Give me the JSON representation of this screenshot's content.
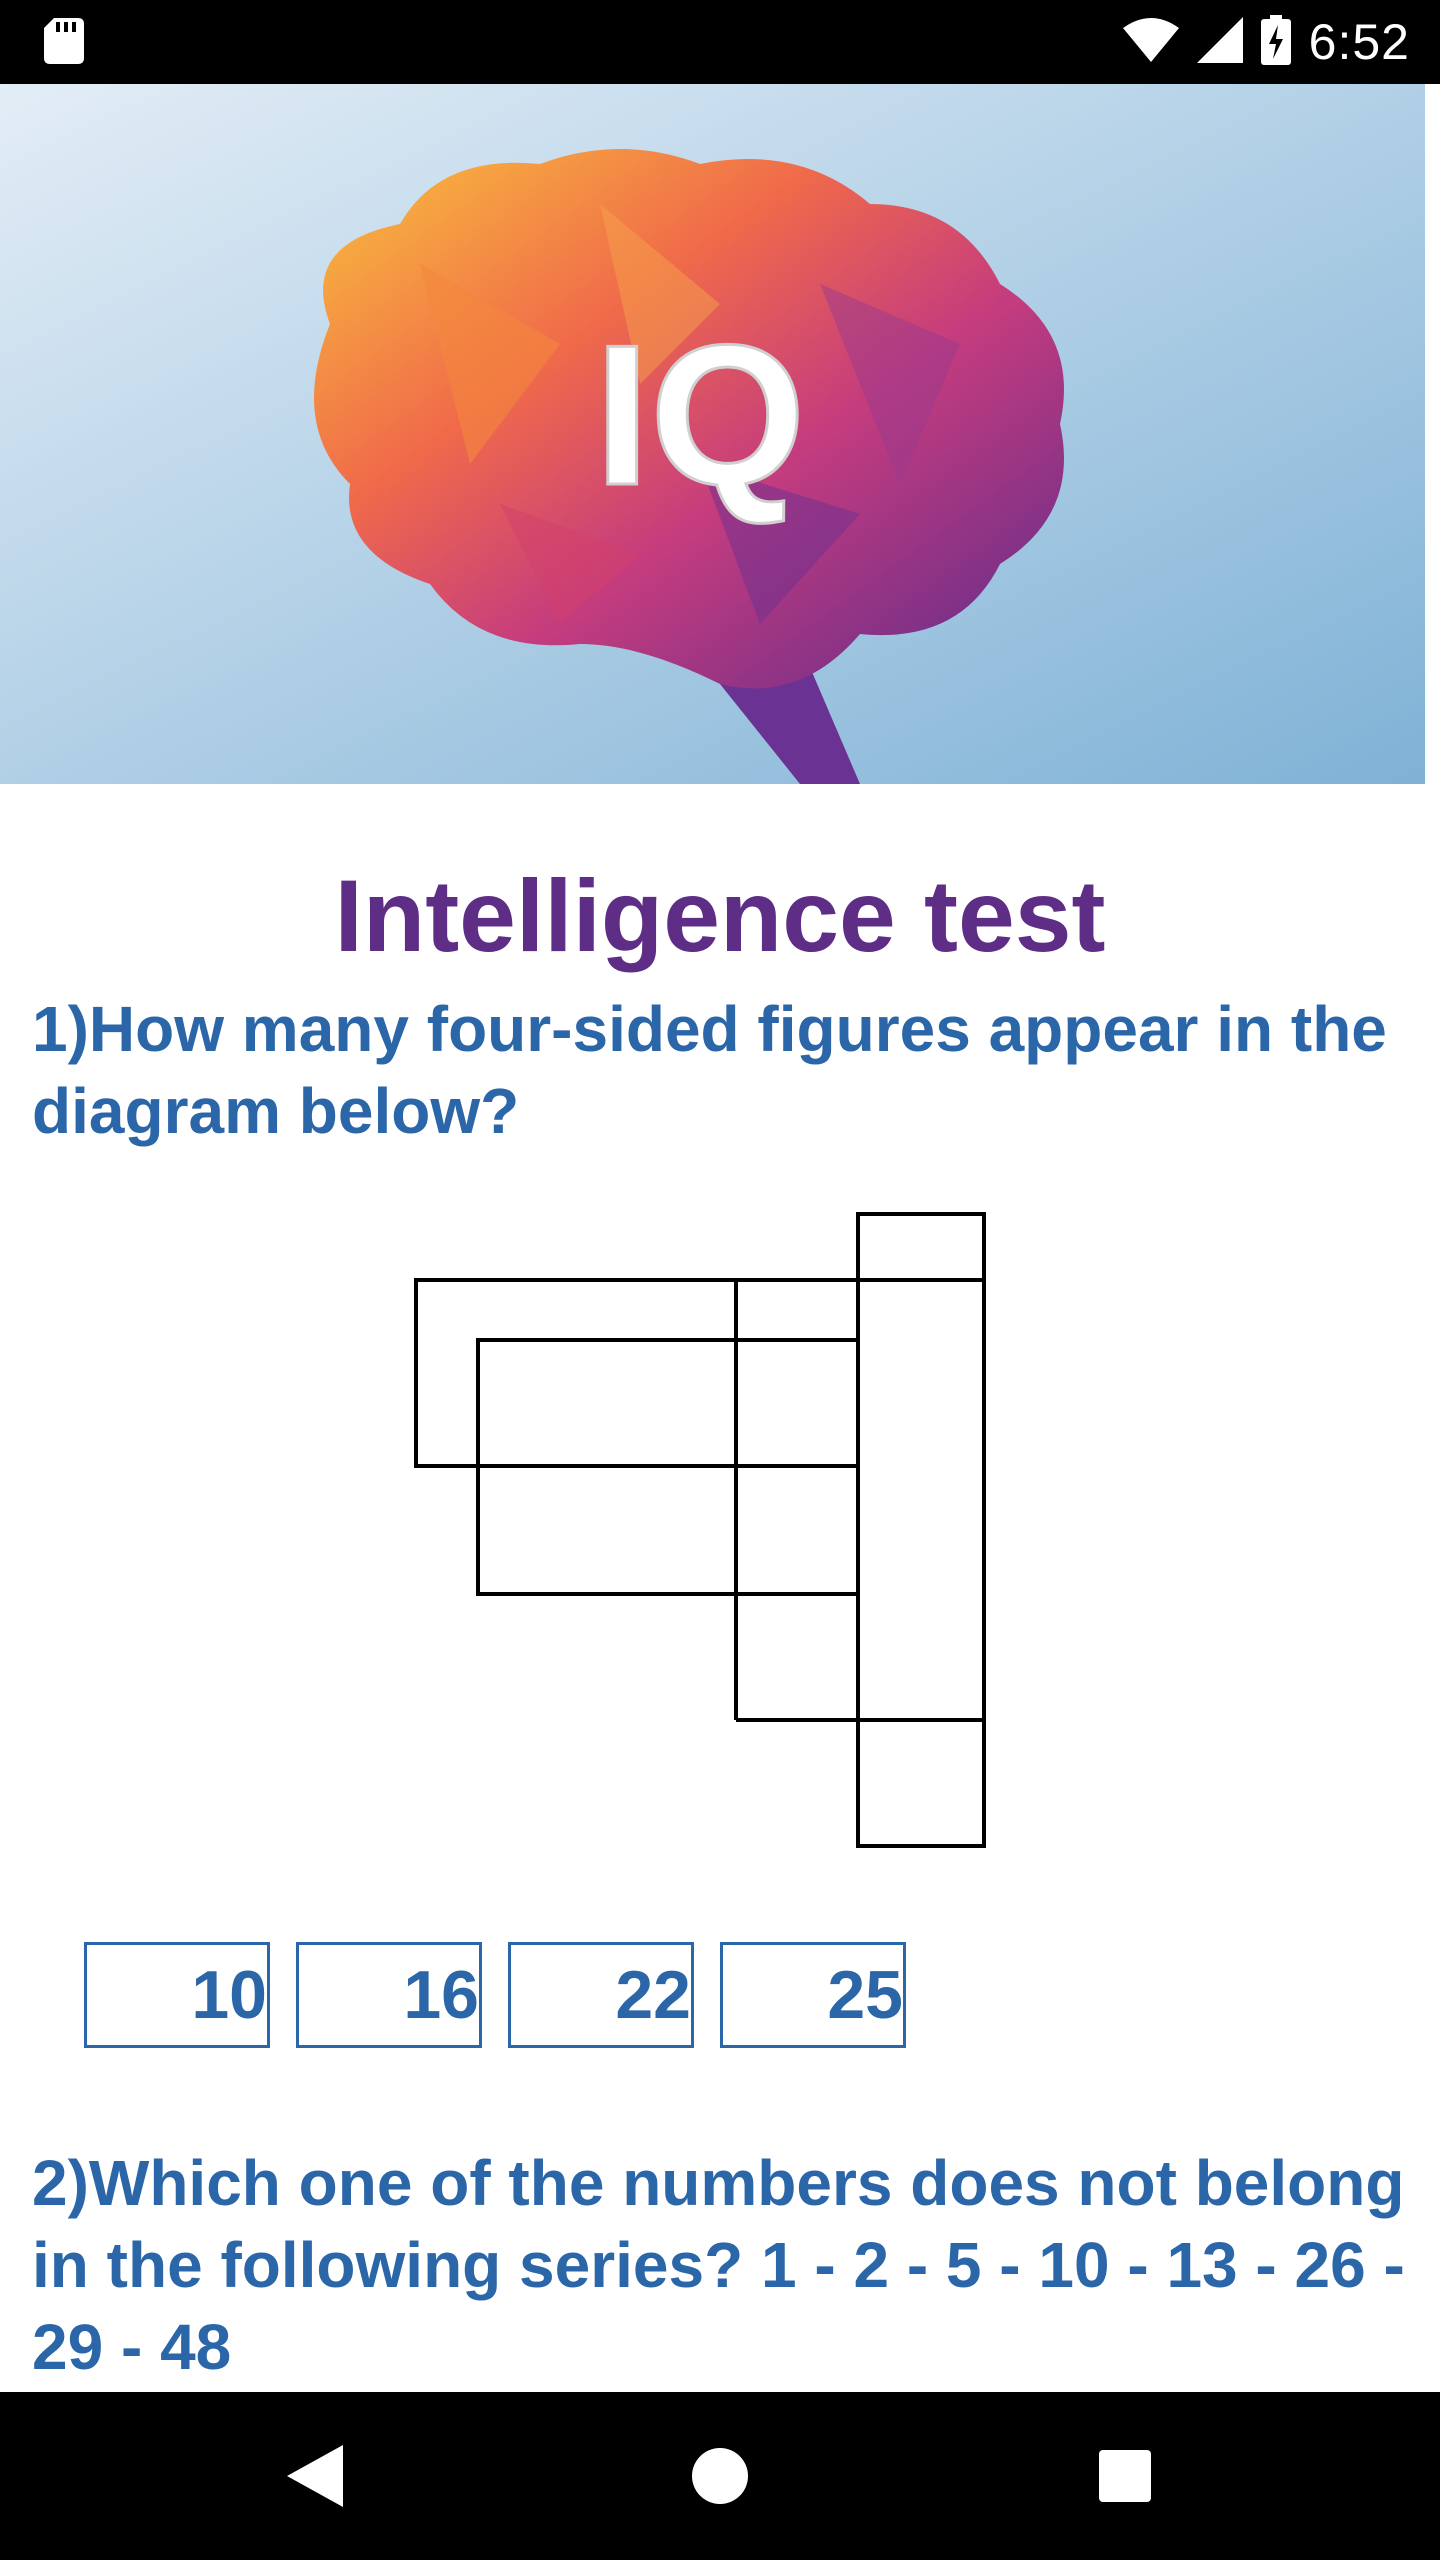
{
  "status_bar": {
    "time": "6:52",
    "icons": [
      "sd-card-icon",
      "wifi-icon",
      "cell-signal-icon",
      "battery-charging-icon"
    ]
  },
  "banner": {
    "logo_text": "IQ",
    "colors": {
      "sky_light": "#dfeaf3",
      "sky_dark": "#7fb3d6"
    }
  },
  "page": {
    "title": "Intelligence test",
    "title_color": "#5e2d86",
    "text_color": "#2b66a8"
  },
  "questions": [
    {
      "text": "1)How many four-sided figures appear in the diagram below?",
      "options": [
        "10",
        "16",
        "22",
        "25"
      ]
    },
    {
      "text": "2)Which one of the numbers does not belong in the following series? 1 - 2 - 5 - 10 - 13 - 26 - 29 - 48"
    }
  ],
  "nav_bar": {
    "icons": [
      "back-icon",
      "home-icon",
      "recents-icon"
    ]
  }
}
